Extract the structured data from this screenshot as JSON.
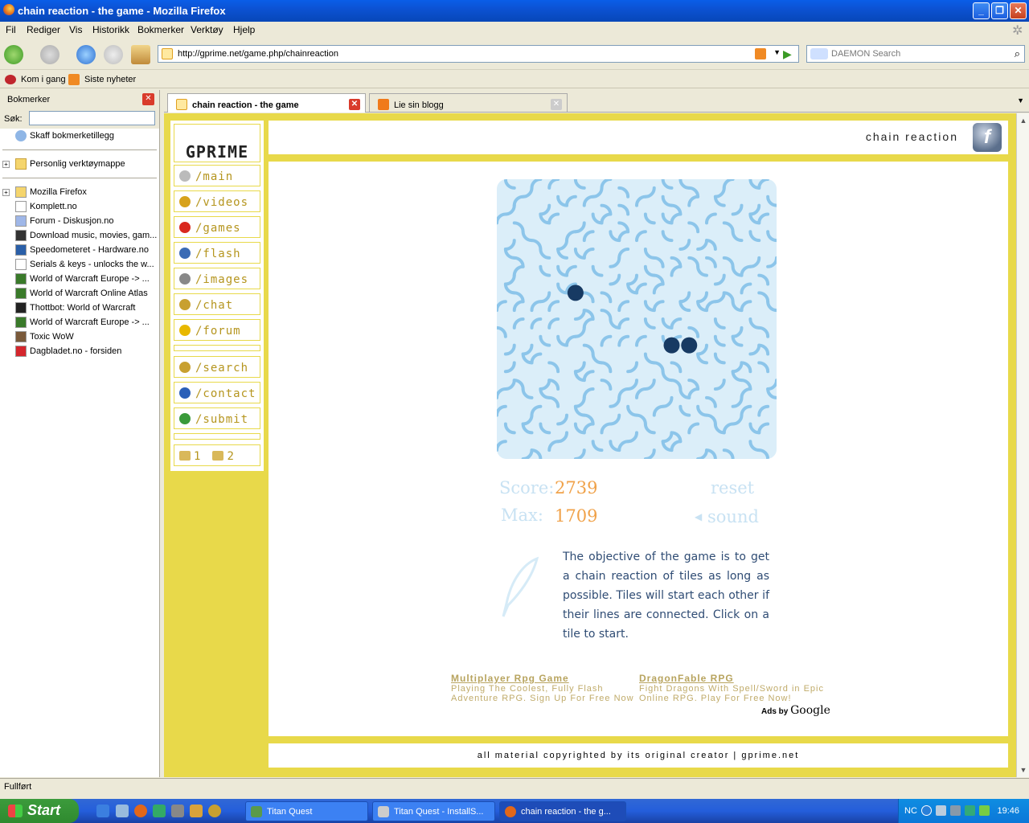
{
  "window": {
    "title": "chain reaction - the game - Mozilla Firefox"
  },
  "menu": [
    "Fil",
    "Rediger",
    "Vis",
    "Historikk",
    "Bokmerker",
    "Verktøy",
    "Hjelp"
  ],
  "nav": {
    "url": "http://gprime.net/game.php/chainreaction",
    "search_placeholder": "DAEMON Search"
  },
  "bookmarks_toolbar": [
    "Kom i gang",
    "Siste nyheter"
  ],
  "sidebar": {
    "title": "Bokmerker",
    "search_label": "Søk:",
    "items_top": [
      {
        "label": "Skaff bokmerketillegg",
        "icon": "addon-icon"
      }
    ],
    "folder1": "Personlig verktøymappe",
    "items": [
      {
        "label": "Mozilla Firefox",
        "icon": "folder-icon",
        "folder": true
      },
      {
        "label": "Komplett.no",
        "icon": "page-icon"
      },
      {
        "label": "Forum - Diskusjon.no",
        "icon": "forum-icon"
      },
      {
        "label": "Download music, movies, gam...",
        "icon": "download-icon"
      },
      {
        "label": "Speedometeret - Hardware.no",
        "icon": "hw-icon"
      },
      {
        "label": "Serials & keys - unlocks the w...",
        "icon": "page-icon"
      },
      {
        "label": "World of Warcraft Europe -> ...",
        "icon": "wow-icon"
      },
      {
        "label": "World of Warcraft Online Atlas",
        "icon": "wow-icon"
      },
      {
        "label": "Thottbot: World of Warcraft",
        "icon": "thottbot-icon"
      },
      {
        "label": "World of Warcraft Europe -> ...",
        "icon": "wow-icon"
      },
      {
        "label": "Toxic WoW",
        "icon": "toxic-icon"
      },
      {
        "label": "Dagbladet.no - forsiden",
        "icon": "db-icon"
      }
    ]
  },
  "tabs": [
    {
      "label": "chain reaction - the game",
      "active": true
    },
    {
      "label": "Lie sin blogg",
      "active": false
    }
  ],
  "site": {
    "logo": "GPRIME",
    "nav": [
      "/main",
      "/videos",
      "/games",
      "/flash",
      "/images",
      "/chat",
      "/forum"
    ],
    "nav2": [
      "/search",
      "/contact",
      "/submit"
    ],
    "pages": [
      "1",
      "2"
    ],
    "page_title": "chain reaction",
    "flash_letter": "f"
  },
  "game": {
    "score_label": "Score:",
    "score": "2739",
    "max_label": "Max:",
    "max": "1709",
    "reset": "reset",
    "sound": "sound",
    "description": "The objective of the game is to get a chain reaction of tiles as long as possible. Tiles will start each other if their lines are connected. Click on a tile to start.",
    "colors": {
      "label": "#c8e2f3",
      "score": "#f0a24a",
      "desc": "#2f4c74",
      "tile": "#8cc5ea",
      "dot": "#173a63"
    }
  },
  "ads": [
    {
      "title": "Multiplayer Rpg Game",
      "text1": "Playing The Coolest, Fully Flash",
      "text2": "Adventure RPG. Sign Up For Free Now"
    },
    {
      "title": "DragonFable RPG",
      "text1": "Fight Dragons With Spell/Sword in Epic",
      "text2": "Online RPG. Play For Free Now!"
    }
  ],
  "ads_by": "Ads by",
  "ads_by_brand": "Google",
  "footer": "all material copyrighted by its original creator | gprime.net",
  "status": "Fullført",
  "taskbar": {
    "start": "Start",
    "buttons": [
      "Titan Quest",
      "Titan Quest - InstallS...",
      "chain reaction - the g..."
    ],
    "lang": "NC",
    "clock": "19:46"
  }
}
